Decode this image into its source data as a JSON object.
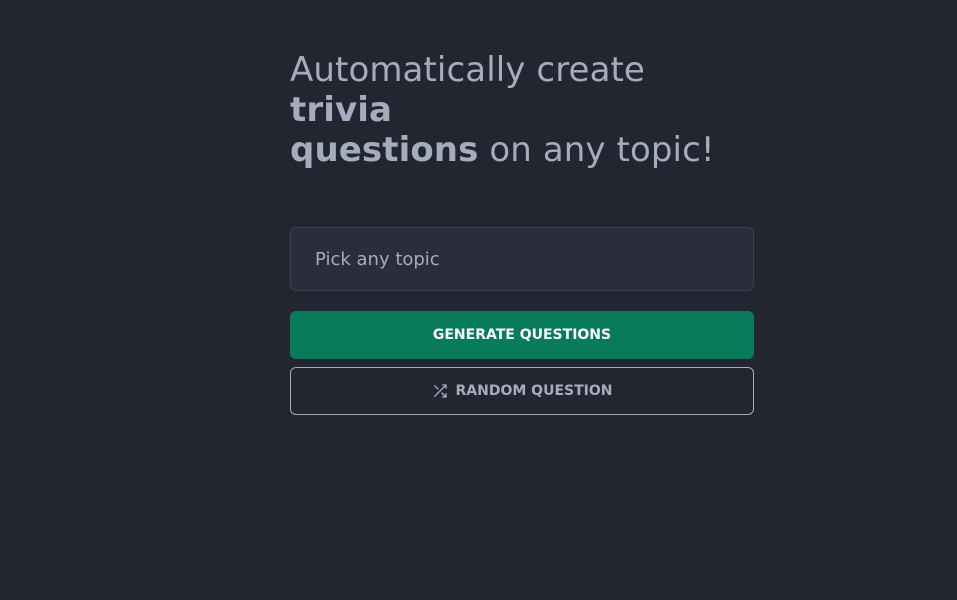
{
  "hero": {
    "title_part1": "Automatically create ",
    "title_bold1": "trivia",
    "title_bold2": "questions",
    "title_part2": " on any topic!"
  },
  "topic_input": {
    "placeholder": "Pick any topic",
    "value": ""
  },
  "generate_button": {
    "label": "GENERATE QUESTIONS",
    "color": "#087c5a"
  },
  "random_button": {
    "label": "RANDOM QUESTION",
    "icon": "shuffle-icon"
  },
  "colors": {
    "background": "#232631",
    "text": "#a4adbe",
    "accent": "#087c5a"
  }
}
